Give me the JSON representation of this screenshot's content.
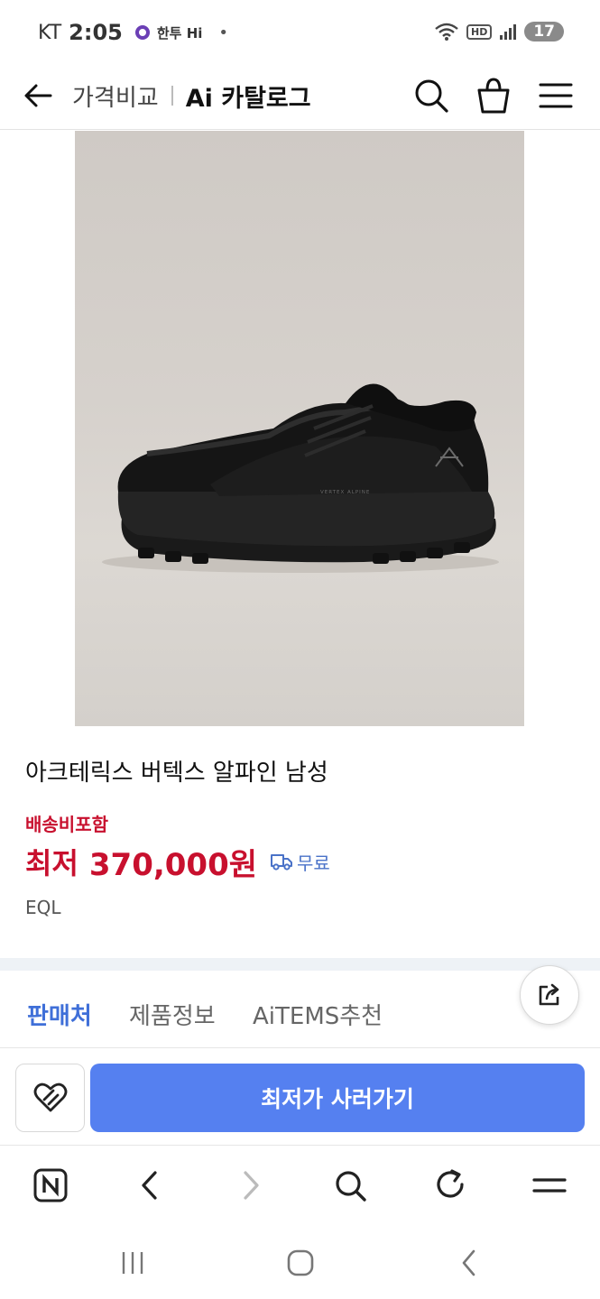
{
  "status": {
    "carrier": "KT",
    "time": "2:05",
    "app_text": "한투 Hi",
    "bullet": "•",
    "hd": "HD",
    "battery": "17"
  },
  "header": {
    "crumb_primary": "가격비교",
    "crumb_active": "Ai 카탈로그"
  },
  "product": {
    "name": "아크테릭스 버텍스 알파인 남성",
    "shipping_note": "배송비포함",
    "price_label": "최저",
    "price_value": "370,000원",
    "delivery_label": "무료",
    "seller": "EQL",
    "shoe_print": "VERTEX ALPINE"
  },
  "tabs": [
    {
      "label": "판매처",
      "active": true
    },
    {
      "label": "제품정보",
      "active": false
    },
    {
      "label": "AiTEMS추천",
      "active": false
    }
  ],
  "actions": {
    "buy_label": "최저가 사러가기"
  },
  "colors": {
    "accent_blue": "#5580f0",
    "tab_active": "#3f6fd8",
    "price_red": "#c8102e",
    "delivery_blue": "#4a72c8"
  },
  "icons": {
    "header": [
      "back-arrow-icon",
      "search-icon",
      "shopping-bag-icon",
      "menu-icon"
    ],
    "browser": [
      "naver-home-icon",
      "browser-back-icon",
      "browser-forward-icon",
      "browser-search-icon",
      "refresh-icon",
      "browser-menu-icon"
    ],
    "system": [
      "recent-apps-icon",
      "home-icon",
      "system-back-icon"
    ]
  }
}
